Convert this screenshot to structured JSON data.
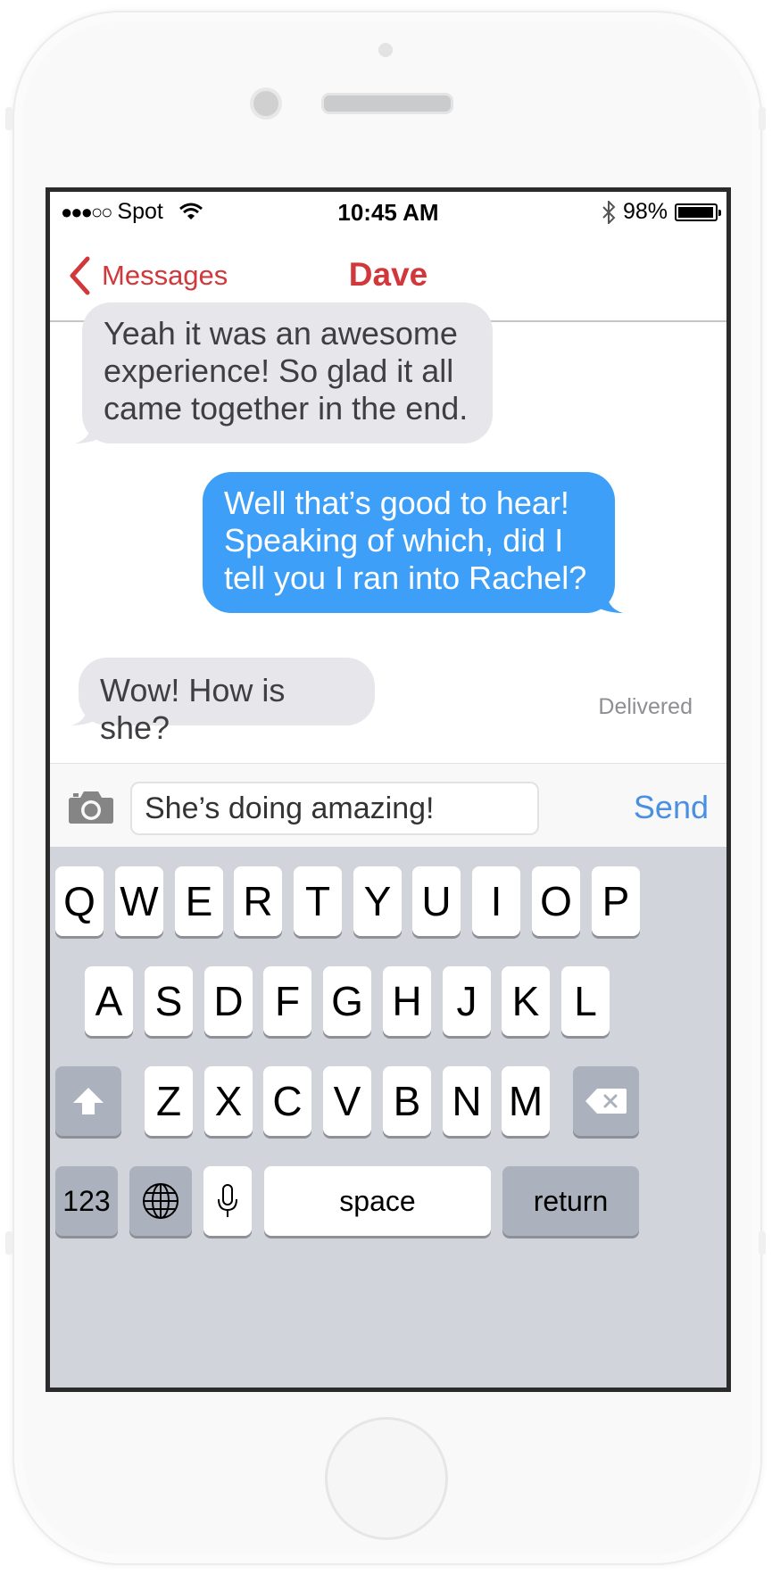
{
  "status_bar": {
    "signal": "●●●○○",
    "carrier": "Spot",
    "time": "10:45 AM",
    "battery": "98%",
    "battery_level": 0.98
  },
  "nav": {
    "back_label": "Messages",
    "title": "Dave"
  },
  "messages": [
    {
      "direction": "incoming",
      "lines": [
        "Yeah it was an awesome",
        "experience! So glad it all",
        "came together in the end."
      ]
    },
    {
      "direction": "outgoing",
      "lines": [
        "Well that’s good to hear!",
        "Speaking of which, did I",
        "tell you I ran into Rachel?"
      ]
    },
    {
      "direction": "incoming",
      "lines": [
        "Wow! How is she?"
      ]
    }
  ],
  "delivered_label": "Delivered",
  "composer": {
    "input_value": "She’s doing amazing!",
    "send_label": "Send"
  },
  "keyboard": {
    "row1": [
      "Q",
      "W",
      "E",
      "R",
      "T",
      "Y",
      "U",
      "I",
      "O",
      "P"
    ],
    "row2": [
      "A",
      "S",
      "D",
      "F",
      "G",
      "H",
      "J",
      "K",
      "L"
    ],
    "row3": [
      "Z",
      "X",
      "C",
      "V",
      "B",
      "N",
      "M"
    ],
    "numbers_label": "123",
    "space_label": "space",
    "return_label": "return"
  },
  "colors": {
    "accent_red": "#d0383b",
    "outgoing_bubble": "#3e9ff8",
    "incoming_bubble": "#e7e7eb",
    "send_blue": "#4a90e2"
  }
}
